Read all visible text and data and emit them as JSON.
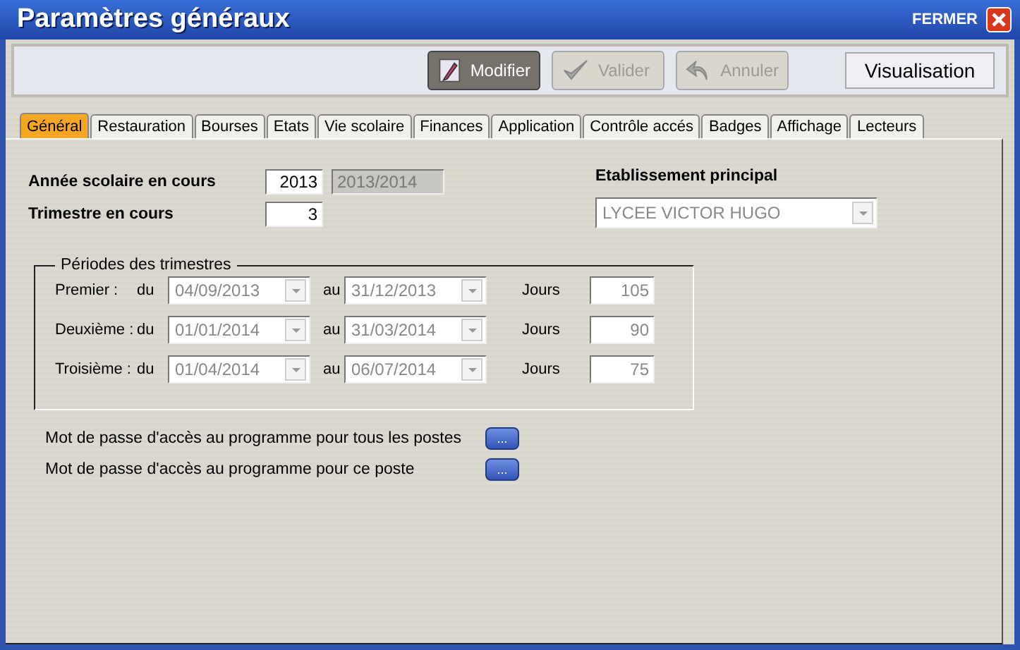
{
  "window": {
    "title": "Paramètres généraux",
    "close_label": "FERMER"
  },
  "toolbar": {
    "buttons": [
      {
        "label": "Modifier",
        "kind": "edit",
        "disabled": false
      },
      {
        "label": "Valider",
        "kind": "validate",
        "disabled": true
      },
      {
        "label": "Annuler",
        "kind": "undo",
        "disabled": true
      }
    ],
    "mode": "Visualisation"
  },
  "tabs": [
    {
      "label": "Général",
      "selected": true
    },
    {
      "label": "Restauration",
      "selected": false
    },
    {
      "label": "Bourses",
      "selected": false
    },
    {
      "label": "Etats",
      "selected": false
    },
    {
      "label": "Vie scolaire",
      "selected": false
    },
    {
      "label": "Finances",
      "selected": false
    },
    {
      "label": "Application",
      "selected": false
    },
    {
      "label": "Contrôle accés",
      "selected": false
    },
    {
      "label": "Badges",
      "selected": false
    },
    {
      "label": "Affichage",
      "selected": false
    },
    {
      "label": "Lecteurs",
      "selected": false
    }
  ],
  "school_year": {
    "label": "Année scolaire en cours",
    "value": "2013",
    "period": "2013/2014"
  },
  "term": {
    "label": "Trimestre en cours",
    "value": "3"
  },
  "main_school": {
    "label": "Etablissement principal",
    "value": "LYCEE VICTOR HUGO",
    "disabled": true
  },
  "periods": {
    "title": "Périodes des trimestres",
    "rows": [
      {
        "label": "Premier :",
        "from_label": "du",
        "from": "04/09/2013",
        "to_label": "au",
        "to": "31/12/2013",
        "days_label": "Jours",
        "days": "105"
      },
      {
        "label": "Deuxième :",
        "from_label": "du",
        "from": "01/01/2014",
        "to_label": "au",
        "to": "31/03/2014",
        "days_label": "Jours",
        "days": "90"
      },
      {
        "label": "Troisième :",
        "from_label": "du",
        "from": "01/04/2014",
        "to_label": "au",
        "to": "06/07/2014",
        "days_label": "Jours",
        "days": "75"
      }
    ],
    "disabled": true
  },
  "passwords": [
    {
      "label": "Mot de passe d'accès au programme pour tous les postes",
      "button": "..."
    },
    {
      "label": "Mot de passe d'accès au programme pour ce poste",
      "button": "..."
    }
  ]
}
